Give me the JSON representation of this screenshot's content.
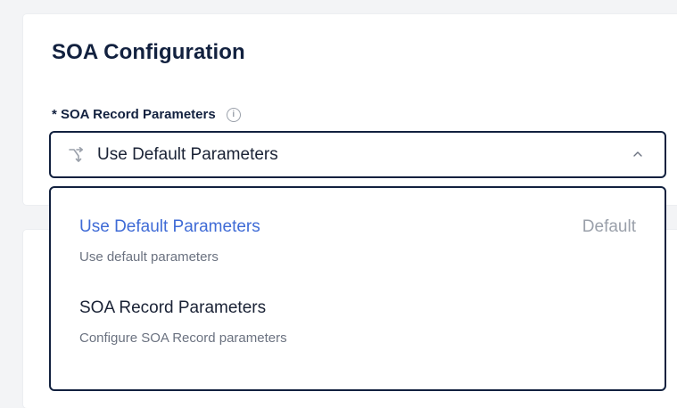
{
  "section": {
    "title": "SOA Configuration"
  },
  "field": {
    "label": "* SOA Record Parameters",
    "info_icon": "info-icon"
  },
  "select": {
    "icon": "merge-arrows-icon",
    "value": "Use Default Parameters",
    "chevron": "chevron-up-icon"
  },
  "dropdown": {
    "options": [
      {
        "label": "Use Default Parameters",
        "description": "Use default parameters",
        "badge": "Default",
        "selected": true
      },
      {
        "label": "SOA Record Parameters",
        "description": "Configure SOA Record parameters",
        "selected": false
      }
    ]
  },
  "colors": {
    "text_dark": "#12213f",
    "selected_option": "#3f6bd6",
    "muted": "#9aa0aa"
  }
}
